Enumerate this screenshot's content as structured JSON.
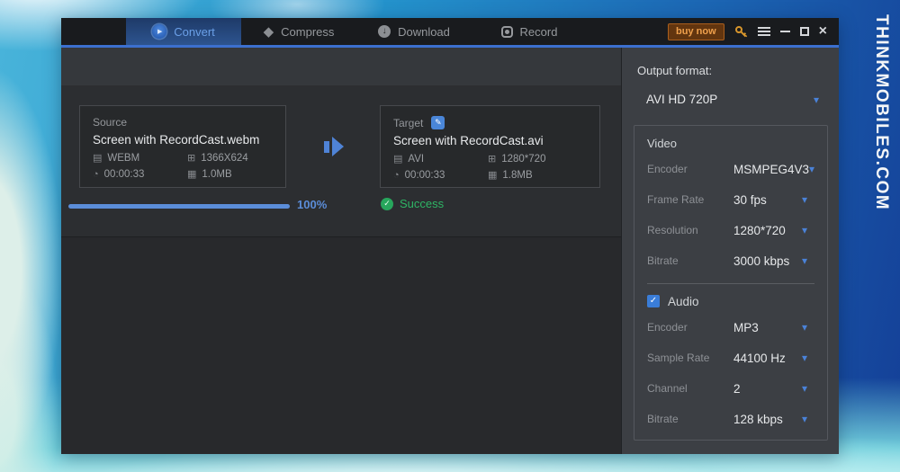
{
  "watermark": "THINKMOBILES.COM",
  "window": {
    "tabs": [
      {
        "label": "Convert"
      },
      {
        "label": "Compress"
      },
      {
        "label": "Download"
      },
      {
        "label": "Record"
      }
    ],
    "titlebar": {
      "buy_now_label": "buy now"
    }
  },
  "source": {
    "label": "Source",
    "filename": "Screen with RecordCast.webm",
    "format": "WEBM",
    "resolution": "1366X624",
    "duration": "00:00:33",
    "size": "1.0MB"
  },
  "target": {
    "label": "Target",
    "filename": "Screen with RecordCast.avi",
    "format": "AVI",
    "resolution": "1280*720",
    "duration": "00:00:33",
    "size": "1.8MB"
  },
  "progress": {
    "percent": "100%",
    "status": "Success"
  },
  "sidebar": {
    "output_format_label": "Output format:",
    "output_format_value": "AVI HD 720P",
    "video": {
      "title": "Video",
      "rows": [
        {
          "label": "Encoder",
          "value": "MSMPEG4V3"
        },
        {
          "label": "Frame Rate",
          "value": "30 fps"
        },
        {
          "label": "Resolution",
          "value": "1280*720"
        },
        {
          "label": "Bitrate",
          "value": "3000 kbps"
        }
      ]
    },
    "audio": {
      "title": "Audio",
      "checked": true,
      "rows": [
        {
          "label": "Encoder",
          "value": "MP3"
        },
        {
          "label": "Sample Rate",
          "value": "44100 Hz"
        },
        {
          "label": "Channel",
          "value": "2"
        },
        {
          "label": "Bitrate",
          "value": "128 kbps"
        }
      ]
    }
  },
  "icons": {
    "play": "▶",
    "gem": "◆",
    "down_arrow": "↓",
    "close": "×",
    "edit": "✎",
    "check": "✓",
    "dropdown": "▾",
    "format": "▤",
    "resolution": "⊞",
    "time": "◔",
    "size": "▦"
  },
  "colors": {
    "accent_blue": "#4a82d8",
    "progress_blue": "#5b8dd9",
    "success_green": "#2eb565",
    "buy_now_orange": "#efa04c",
    "active_tab_blue": "#2d548f"
  }
}
